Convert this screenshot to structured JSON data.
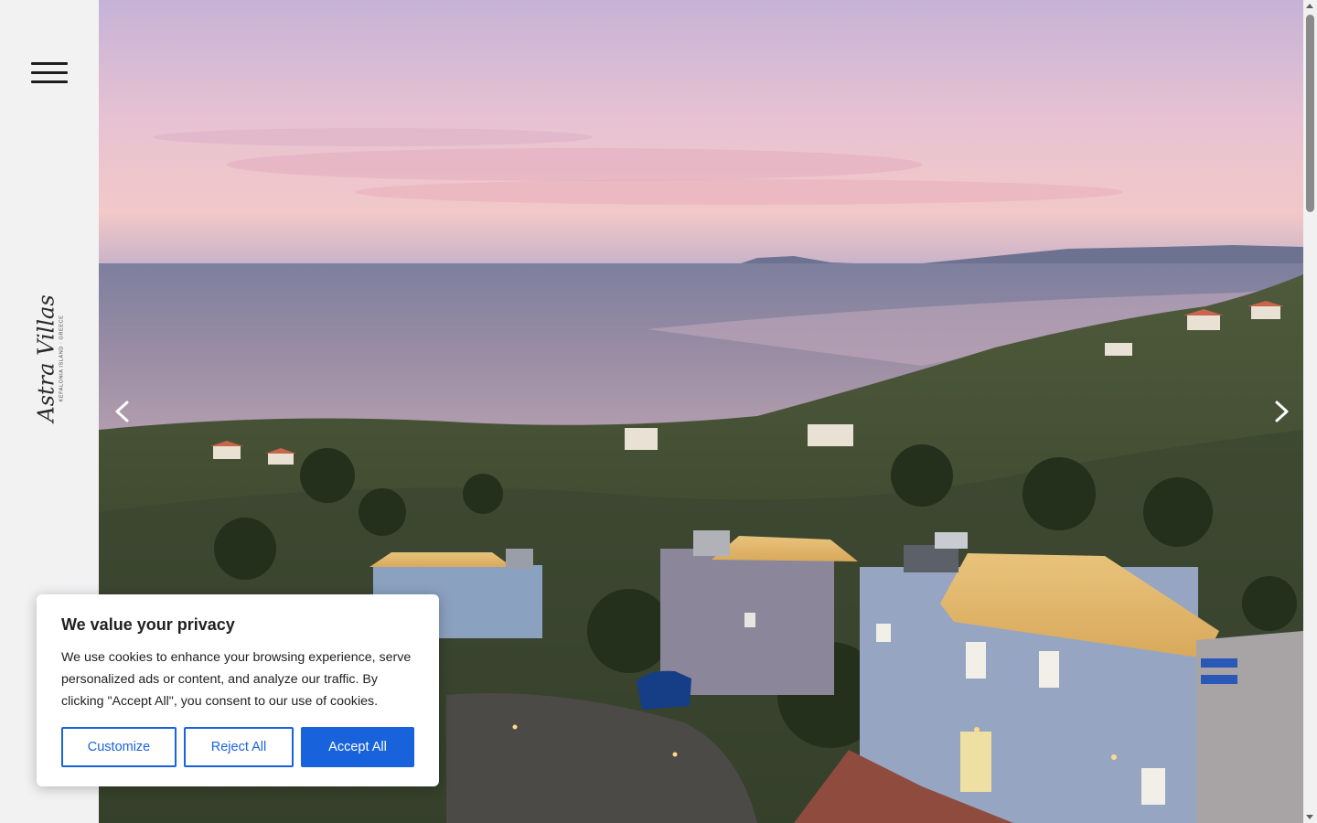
{
  "sidebar": {
    "menu_icon": "hamburger-menu-icon",
    "logo": {
      "script": "Astra Villas",
      "subtitle": "KEFALONIA ISLAND · GREECE"
    }
  },
  "hero": {
    "image": "aerial view of villas overlooking the sea at sunset",
    "prev_icon": "chevron-left-icon",
    "next_icon": "chevron-right-icon"
  },
  "cookie_banner": {
    "title": "We value your privacy",
    "text": "We use cookies to enhance your browsing experience, serve personalized ads or content, and analyze our traffic. By clicking \"Accept All\", you consent to our use of cookies.",
    "customize_label": "Customize",
    "reject_label": "Reject All",
    "accept_label": "Accept All",
    "accent_color": "#1863dc"
  }
}
